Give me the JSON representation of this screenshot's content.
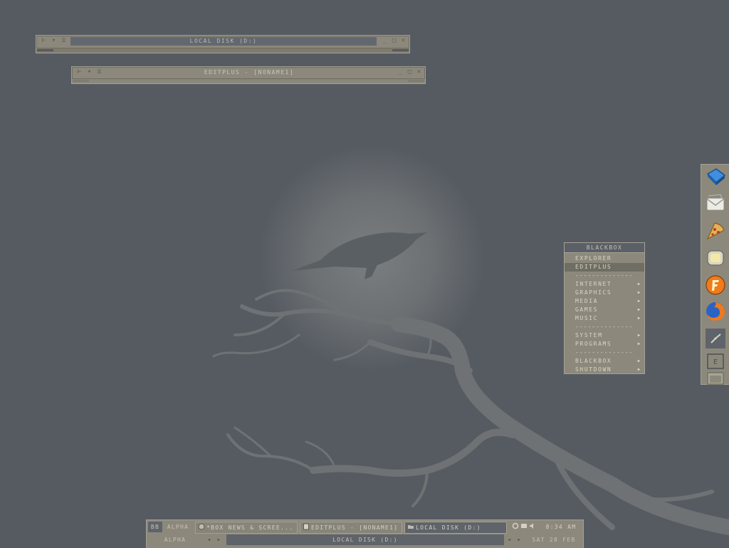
{
  "windows": [
    {
      "title": "LOCAL DISK (D:)"
    },
    {
      "title": "EDITPLUS - [NONAME1]"
    }
  ],
  "root_menu": {
    "title": "BLACKBOX",
    "items": [
      {
        "label": "EXPLORER"
      },
      {
        "label": "EDITPLUS"
      },
      {
        "label": "INTERNET"
      },
      {
        "label": "GRAPHICS"
      },
      {
        "label": "MEDIA"
      },
      {
        "label": "GAMES"
      },
      {
        "label": "MUSIC"
      },
      {
        "label": "SYSTEM"
      },
      {
        "label": "PROGRAMS"
      },
      {
        "label": "BLACKBOX"
      },
      {
        "label": "SHUTDOWN"
      }
    ],
    "separator": "--------------"
  },
  "slit_icons": [
    "notebook-icon",
    "mail-icon",
    "pizza-icon",
    "tv-icon",
    "fl-studio-icon",
    "firefox-icon",
    "clock-icon",
    "box-e-icon",
    "window-icon"
  ],
  "toolbar": {
    "label_bb": "BB",
    "workspace": "ALPHA",
    "tasks": [
      {
        "label": "*BOX NEWS & SCREE..."
      },
      {
        "label": "EDITPLUS - [NONAME1]"
      },
      {
        "label": "LOCAL DISK (D:)"
      }
    ],
    "clock": "8:34 AM",
    "workspace_bottom": "ALPHA",
    "window_label": "LOCAL DISK (D:)",
    "date": "SAT 28 FEB"
  },
  "colors": {
    "desktop": "#565b62",
    "frame": "#8c897c",
    "title": "#636870"
  }
}
